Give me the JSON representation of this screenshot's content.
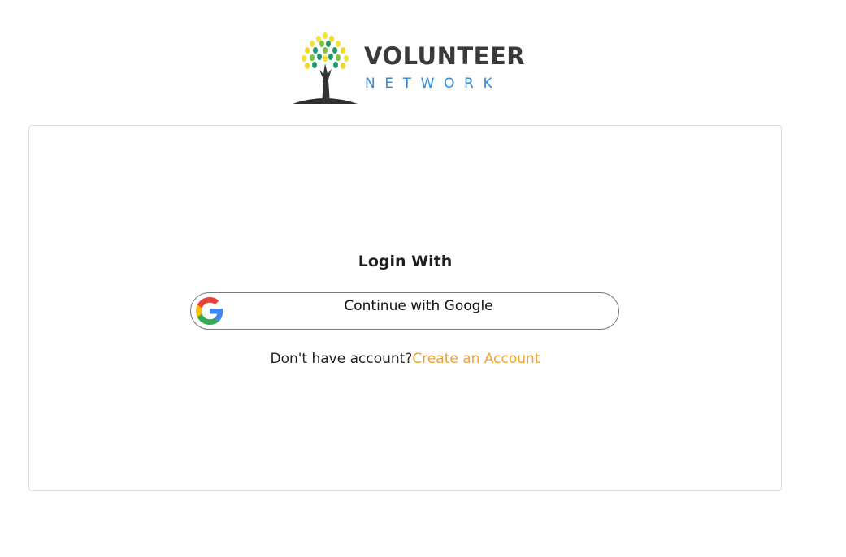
{
  "logo": {
    "word_1": "VOLUNTEER",
    "word_2": "NETWORK"
  },
  "login": {
    "title": "Login With",
    "google_button_label": "Continue with Google",
    "signup_prompt": "Don't have account?",
    "signup_link": "Create an Account"
  },
  "colors": {
    "link": "#f0a030",
    "logo_blue": "#2d8bd9",
    "logo_dark": "#3a3a3a"
  },
  "icons": {
    "logo": "tree-icon",
    "google": "google-g-icon"
  }
}
